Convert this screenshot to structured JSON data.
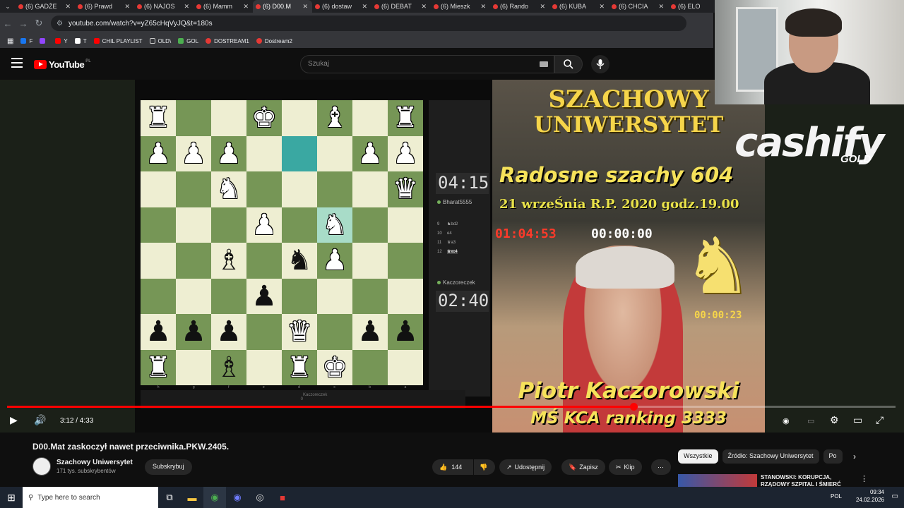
{
  "browser": {
    "tabs": [
      {
        "label": "(6) GADŻE"
      },
      {
        "label": "(6) Prawd"
      },
      {
        "label": "(6) NAJOS"
      },
      {
        "label": "(6) Mamm"
      },
      {
        "label": "(6) D00.M",
        "active": true
      },
      {
        "label": "(6) dostaw"
      },
      {
        "label": "(6) DEBAT"
      },
      {
        "label": "(6) Mieszk"
      },
      {
        "label": "(6) Rando"
      },
      {
        "label": "(6) KUBA"
      },
      {
        "label": "(6) CHCIA"
      },
      {
        "label": "(6) ELO"
      }
    ],
    "url": "youtube.com/watch?v=yZ65cHqVyJQ&t=180s",
    "bookmarks": [
      "F",
      "Y",
      "T",
      "CHIL PLAYLIST",
      "OLD\\",
      "GOL",
      "DOSTREAM1",
      "Dostream2"
    ]
  },
  "youtube": {
    "logo_text": "YouTube",
    "logo_region": "PL",
    "search_placeholder": "Szukaj"
  },
  "chess": {
    "top_player": "Bharat5555",
    "top_clock": "04:15",
    "bottom_player": "Kaczoreczek",
    "bottom_clock": "02:40",
    "moves": [
      {
        "num": "9",
        "move": "♞bd2"
      },
      {
        "num": "10",
        "move": "e4"
      },
      {
        "num": "11",
        "move": "♛a3"
      },
      {
        "num": "12",
        "move": "♛xc4",
        "selected": true
      }
    ],
    "under_label": "Kaczoreczek",
    "under_score": "0"
  },
  "banner": {
    "title1": "SZACHOWY",
    "title2": "UNIWERSYTET",
    "show": "Radosne szachy 604",
    "date": "21 wrzeŚnia R.P. 2020 godz.19.00",
    "clock_red": "01:04:53",
    "clock_white": "00:00:00",
    "clock_small": "00:00:23",
    "name": "Piotr Kaczorowski",
    "rank": "MŚ KCA ranking 3333"
  },
  "sponsor": {
    "brand": "cashify",
    "sub": "GOLD"
  },
  "player": {
    "time": "3:12 / 4:33",
    "progress_fraction": 0.705
  },
  "video": {
    "title": "D00.Mat zaskoczył nawet przeciwnika.PKW.2405.",
    "channel": "Szachowy Uniwersytet",
    "subscribers": "171 tys. subskrybentów",
    "subscribe_label": "Subskrybuj",
    "likes": "144",
    "share_label": "Udostępnij",
    "save_label": "Zapisz",
    "clip_label": "Klip"
  },
  "chips": [
    "Wszystkie",
    "Źródło: Szachowy Uniwersytet",
    "Po"
  ],
  "recommended": {
    "line1": "STANOWSKI: KORUPCJA,",
    "line2": "RZĄDOWY SZPITAL I ŚMIERĆ"
  },
  "taskbar": {
    "search_placeholder": "Type here to search",
    "lang": "POL",
    "time": "09:34",
    "date": "24.02.2026"
  }
}
